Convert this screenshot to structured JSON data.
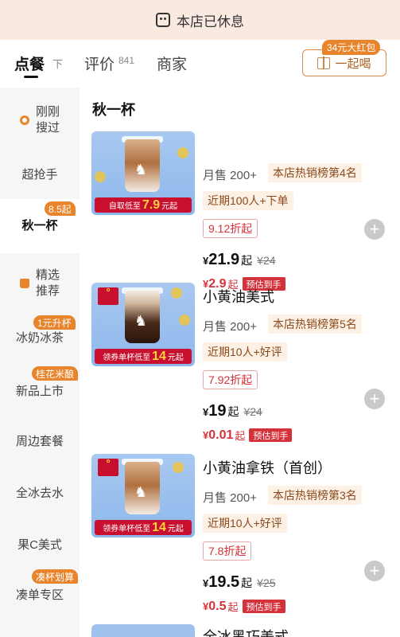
{
  "banner": {
    "text": "本店已休息"
  },
  "tabs": [
    {
      "label": "点餐",
      "active": true
    },
    {
      "label": "评价",
      "count": "841"
    },
    {
      "label": "商家"
    }
  ],
  "tab_sort_glyph": "下",
  "together": {
    "label": "一起喝",
    "badge": "34元大红包"
  },
  "sidebar": {
    "items": [
      {
        "label": "刚刚\n搜过",
        "icon": "recent-dot-icon"
      },
      {
        "label": "超抢手"
      },
      {
        "label": "秋一杯",
        "active": true,
        "badge": "8.5起"
      },
      {
        "label": "精选\n推荐",
        "icon": "thumbs-up-icon"
      },
      {
        "label": "冰奶冰茶",
        "badge": "1元升杯"
      },
      {
        "label": "新品上市",
        "badge": "桂花米酿"
      },
      {
        "label": "周边套餐"
      },
      {
        "label": "全冰去水"
      },
      {
        "label": "果C美式"
      },
      {
        "label": "凑单专区",
        "badge": "凑杯划算"
      }
    ]
  },
  "section": {
    "title": "秋一杯"
  },
  "products": [
    {
      "name": "",
      "sales": "月售 200+",
      "rank": "本店热销榜第4名",
      "recent": "近期100人+下单",
      "discount": "9.12折起",
      "price": {
        "yen": "¥",
        "value": "21.9",
        "qi": "起",
        "original": "¥24"
      },
      "estimate": {
        "yen": "¥",
        "value": "2.9",
        "qi": "起",
        "badge": "预估到手"
      },
      "image_ribbon": {
        "prefix": "自取低至",
        "value": "7.9",
        "suffix": "元起"
      }
    },
    {
      "name": "小黄油美式",
      "sales": "月售 200+",
      "rank": "本店热销榜第5名",
      "recent": "近期10人+好评",
      "discount": "7.92折起",
      "price": {
        "yen": "¥",
        "value": "19",
        "qi": "起",
        "original": "¥24"
      },
      "estimate": {
        "yen": "¥",
        "value": "0.01",
        "qi": "起",
        "badge": "预估到手"
      },
      "image_ribbon": {
        "prefix": "领券单杯低至",
        "value": "14",
        "suffix": "元起"
      }
    },
    {
      "name": "小黄油拿铁（首创）",
      "sales": "月售 200+",
      "rank": "本店热销榜第3名",
      "recent": "近期10人+好评",
      "discount": "7.8折起",
      "price": {
        "yen": "¥",
        "value": "19.5",
        "qi": "起",
        "original": "¥25"
      },
      "estimate": {
        "yen": "¥",
        "value": "0.5",
        "qi": "起",
        "badge": "预估到手"
      },
      "image_ribbon": {
        "prefix": "领券单杯低至",
        "value": "14",
        "suffix": "元起"
      }
    }
  ],
  "next_product": {
    "name": "全冰黑巧美式"
  },
  "colors": {
    "accent": "#e8842b",
    "price_red": "#d4323a",
    "banner_bg": "#fae9e1",
    "tag_bg": "#fdf0e4"
  }
}
